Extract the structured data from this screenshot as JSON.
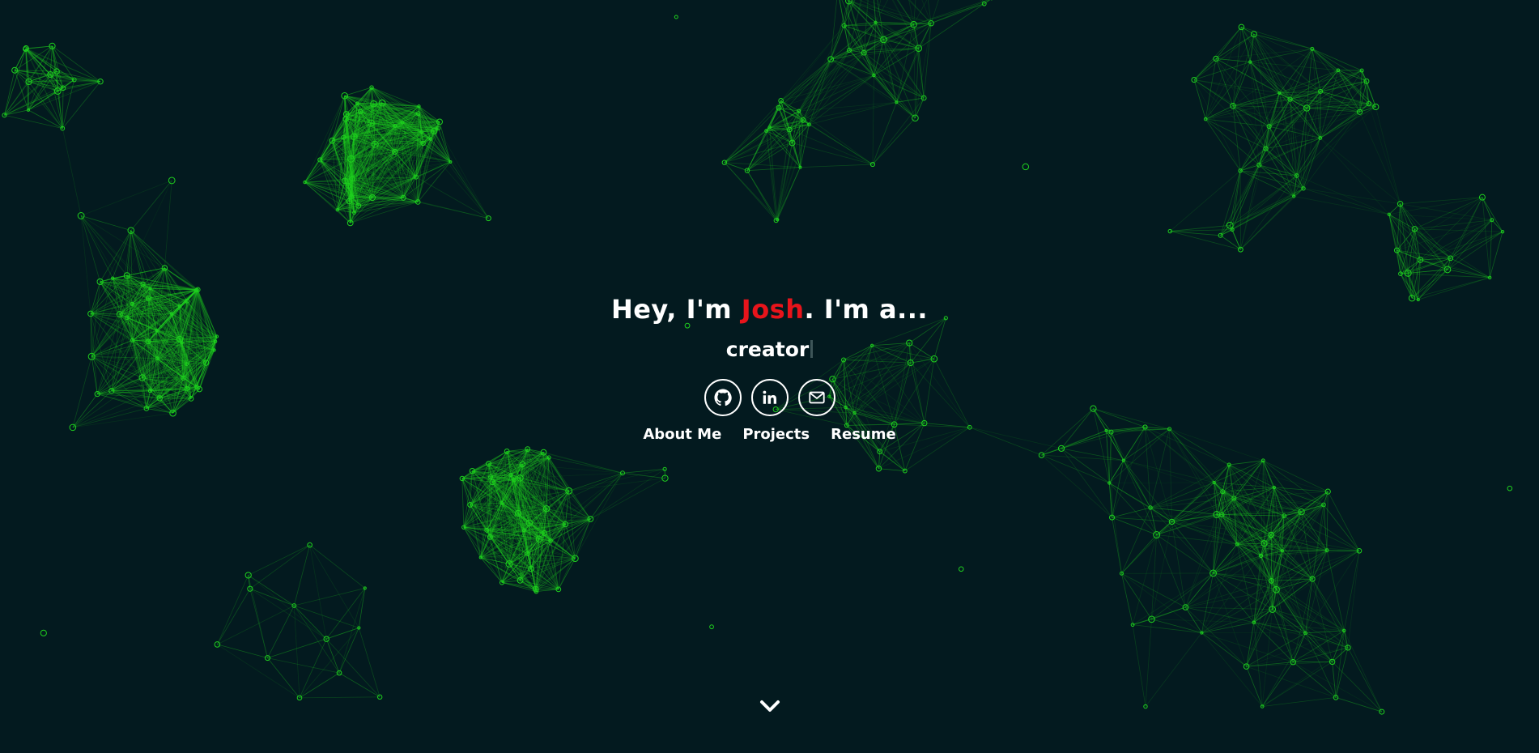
{
  "hero": {
    "greeting": "Hey, I'm ",
    "name": "Josh",
    "suffix": ". I'm a...",
    "role": "creator"
  },
  "socials": [
    {
      "icon": "github-icon"
    },
    {
      "icon": "linkedin-icon"
    },
    {
      "icon": "mail-icon"
    }
  ],
  "nav": {
    "about": "About Me",
    "projects": "Projects",
    "resume": "Resume"
  },
  "scroll_icon": "chevron-down-icon",
  "colors": {
    "background": "#031a1f",
    "accent": "#e8141b",
    "particle": "#1fd01f",
    "text": "#ffffff"
  },
  "background_effect": "particle-network"
}
